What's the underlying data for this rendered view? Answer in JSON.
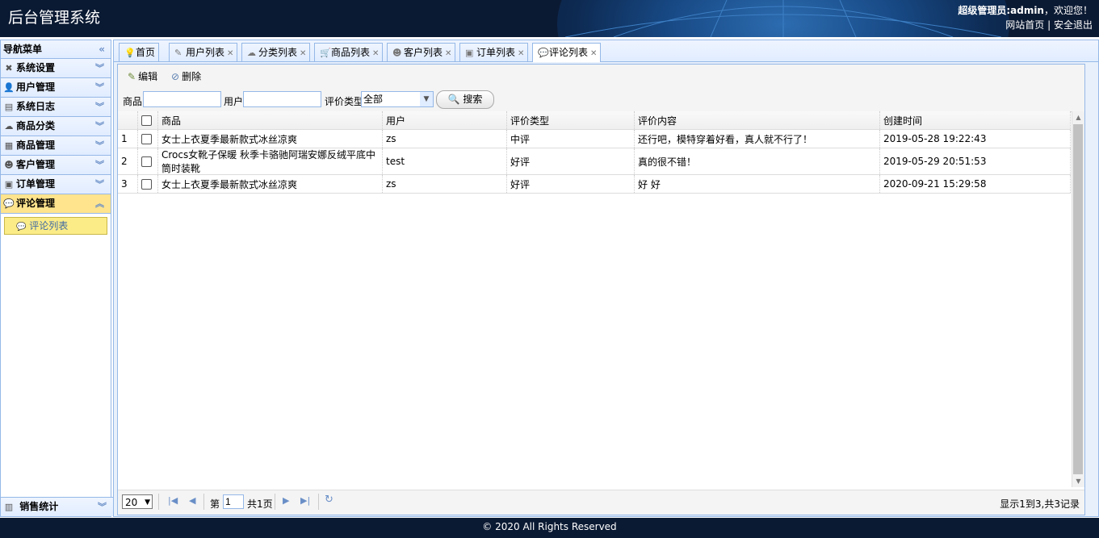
{
  "header": {
    "app_title": "后台管理系统",
    "welcome_user": "超级管理员:admin",
    "welcome_suffix": "，欢迎您！",
    "link_home": "网站首页",
    "link_sep": "|",
    "link_logout": "安全退出"
  },
  "sidebar": {
    "title": "导航菜单",
    "collapse_icon": "«",
    "items": [
      {
        "label": "系统设置",
        "icon": "tools-icon",
        "glyph": "✖"
      },
      {
        "label": "用户管理",
        "icon": "user-icon",
        "glyph": "👤"
      },
      {
        "label": "系统日志",
        "icon": "log-icon",
        "glyph": "▤"
      },
      {
        "label": "商品分类",
        "icon": "category-icon",
        "glyph": "☁"
      },
      {
        "label": "商品管理",
        "icon": "product-icon",
        "glyph": "▦"
      },
      {
        "label": "客户管理",
        "icon": "customer-icon",
        "glyph": "☻"
      },
      {
        "label": "订单管理",
        "icon": "order-icon",
        "glyph": "▣"
      },
      {
        "label": "评论管理",
        "icon": "comment-icon",
        "glyph": "💬"
      }
    ],
    "sub_item": "评论列表",
    "bottom_item": "销售统计"
  },
  "tabs": [
    {
      "label": "首页",
      "closable": false,
      "glyph": "💡"
    },
    {
      "label": "用户列表",
      "closable": true,
      "glyph": "✎"
    },
    {
      "label": "分类列表",
      "closable": true,
      "glyph": "☁"
    },
    {
      "label": "商品列表",
      "closable": true,
      "glyph": "🛒"
    },
    {
      "label": "客户列表",
      "closable": true,
      "glyph": "☻"
    },
    {
      "label": "订单列表",
      "closable": true,
      "glyph": "▣"
    },
    {
      "label": "评论列表",
      "closable": true,
      "glyph": "💬",
      "selected": true
    }
  ],
  "toolbar": {
    "edit_label": "编辑",
    "delete_label": "删除"
  },
  "search": {
    "product_label": "商品:",
    "product_value": "",
    "user_label": "用户:",
    "user_value": "",
    "type_label": "评价类型:",
    "type_value": "全部",
    "button_label": "搜索"
  },
  "grid": {
    "columns": [
      "商品",
      "用户",
      "评价类型",
      "评价内容",
      "创建时间"
    ],
    "rows": [
      {
        "num": "1",
        "product": "女士上衣夏季最新款式冰丝凉爽",
        "user": "zs",
        "type": "中评",
        "content": "还行吧，模特穿着好看，真人就不行了！",
        "time": "2019-05-28 19:22:43"
      },
      {
        "num": "2",
        "product": "Crocs女靴子保暖 秋季卡骆驰阿瑞安娜反绒平底中筒时装靴",
        "user": "test",
        "type": "好评",
        "content": "真的很不错！",
        "time": "2019-05-29 20:51:53"
      },
      {
        "num": "3",
        "product": "女士上衣夏季最新款式冰丝凉爽",
        "user": "zs",
        "type": "好评",
        "content": "好 好",
        "time": "2020-09-21 15:29:58"
      }
    ]
  },
  "pager": {
    "page_size": "20",
    "page_prefix": "第",
    "page_value": "1",
    "page_suffix": "共1页",
    "info": "显示1到3,共3记录"
  },
  "footer": {
    "copyright": "© 2020 All Rights Reserved"
  }
}
